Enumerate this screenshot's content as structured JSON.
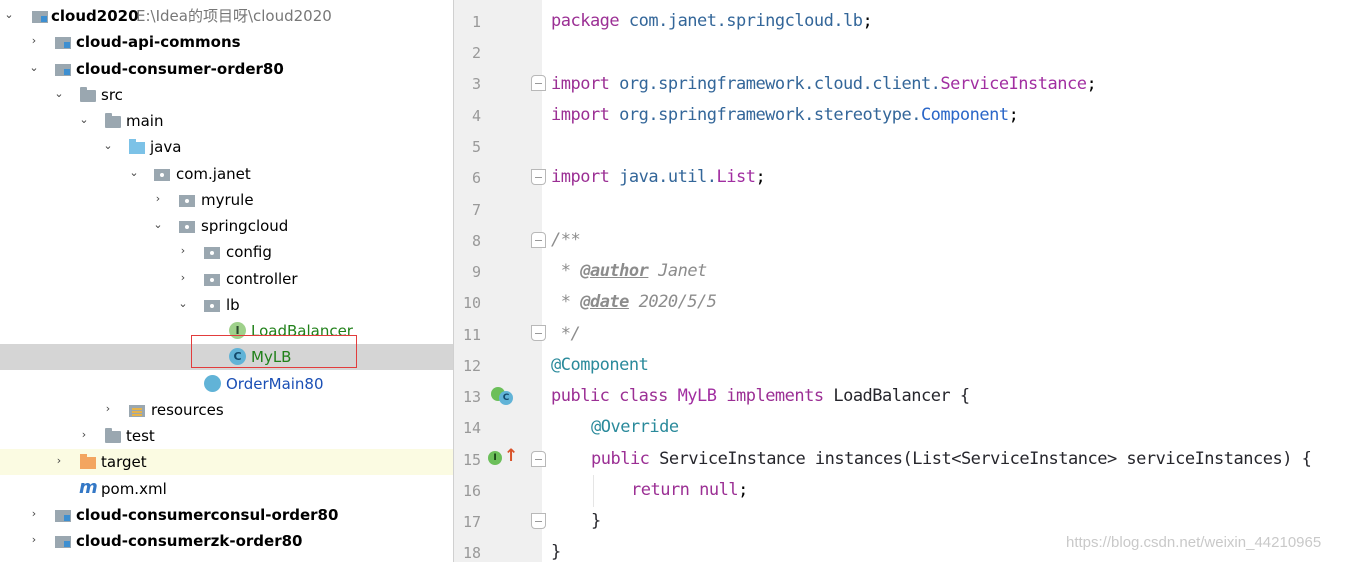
{
  "tree": {
    "project": {
      "name": "cloud2020",
      "path": "E:\\Idea的项目呀\\cloud2020"
    },
    "items": [
      {
        "label": "cloud-api-commons"
      },
      {
        "label": "cloud-consumer-order80"
      },
      {
        "label": "src"
      },
      {
        "label": "main"
      },
      {
        "label": "java"
      },
      {
        "label": "com.janet"
      },
      {
        "label": "myrule"
      },
      {
        "label": "springcloud"
      },
      {
        "label": "config"
      },
      {
        "label": "controller"
      },
      {
        "label": "lb"
      },
      {
        "label": "LoadBalancer",
        "badge": "I"
      },
      {
        "label": "MyLB",
        "badge": "C"
      },
      {
        "label": "OrderMain80"
      },
      {
        "label": "resources"
      },
      {
        "label": "test"
      },
      {
        "label": "target"
      },
      {
        "label": "pom.xml",
        "badge": "m"
      },
      {
        "label": "cloud-consumerconsul-order80"
      },
      {
        "label": "cloud-consumerzk-order80"
      }
    ]
  },
  "editor": {
    "line_numbers": [
      "1",
      "2",
      "3",
      "4",
      "5",
      "6",
      "7",
      "8",
      "9",
      "10",
      "11",
      "12",
      "13",
      "14",
      "15",
      "16",
      "17",
      "18"
    ],
    "gutter_badges": {
      "implementing": "C",
      "implemented": "I"
    },
    "lines": {
      "l1_kw": "package",
      "l1_pkg": " com.janet.springcloud.lb",
      "l1_end": ";",
      "l3_kw": "import",
      "l3_pkg": " org.springframework.cloud.client.",
      "l3_cls": "ServiceInstance",
      "l3_end": ";",
      "l4_kw": "import",
      "l4_pkg": " org.springframework.stereotype.",
      "l4_cls": "Component",
      "l4_end": ";",
      "l6_kw": "import",
      "l6_pkg": " java.util.",
      "l6_cls": "List",
      "l6_end": ";",
      "l8": "/**",
      "l9_star": " * ",
      "l9_tag": "@author",
      "l9_val": " Janet",
      "l10_star": " * ",
      "l10_tag": "@date",
      "l10_val": " 2020/5/5",
      "l11": " */",
      "l12": "@Component",
      "l13_kw": "public class",
      "l13_name": " MyLB",
      "l13_impl": " implements",
      "l13_rest": " LoadBalancer {",
      "l14": "@Override",
      "l15_kw": "public",
      "l15_rest": " ServiceInstance instances(List<ServiceInstance> serviceInstances) {",
      "l16_kw": "return null",
      "l16_end": ";",
      "l17": "}",
      "l18": "}"
    }
  },
  "watermark": "https://blog.csdn.net/weixin_44210965"
}
